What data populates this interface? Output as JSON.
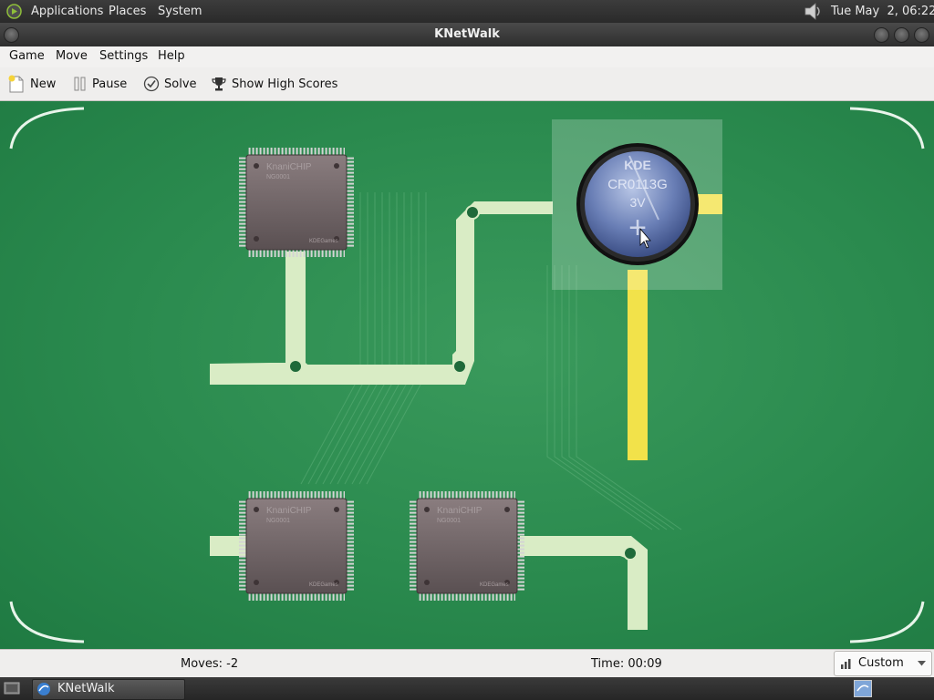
{
  "top_panel": {
    "applications": "Applications",
    "places": "Places",
    "system": "System",
    "clock": "Tue May  2, 06:22"
  },
  "window": {
    "title": "KNetWalk"
  },
  "menu": {
    "game": "Game",
    "move": "Move",
    "settings": "Settings",
    "help": "Help"
  },
  "toolbar": {
    "new_label": "New",
    "pause_label": "Pause",
    "solve_label": "Solve",
    "highscores_label": "Show High Scores"
  },
  "board": {
    "chip_brand": "KnaniCHIP",
    "chip_model": "NG0001",
    "chip_footer": "KDEGames",
    "battery_brand": "KDE",
    "battery_model": "CR0113G",
    "battery_voltage": "3V",
    "battery_sign": "+"
  },
  "status": {
    "moves": "Moves: -2",
    "time": "Time: 00:09",
    "difficulty": "Custom"
  },
  "taskbar": {
    "window_label": "KNetWalk"
  },
  "colors": {
    "board_green": "#2a8a4e",
    "trace_light": "#d9ecc5",
    "trace_powered": "#f2e24a"
  }
}
